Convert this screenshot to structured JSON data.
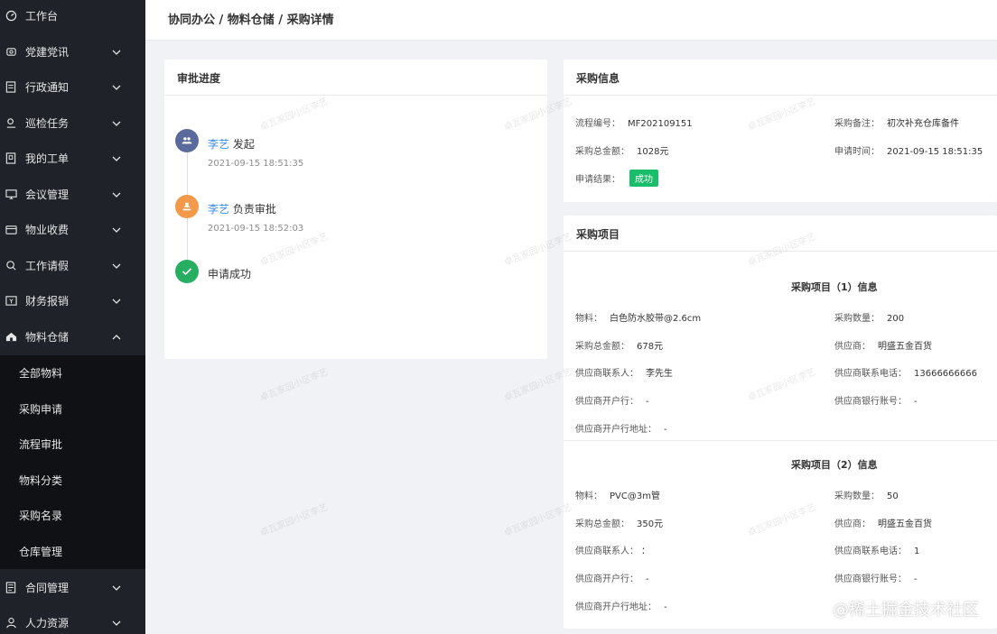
{
  "breadcrumb": "协同办公 / 物料仓储 / 采购详情",
  "sidebar": {
    "items": [
      {
        "label": "工作台",
        "icon": "dashboard-icon",
        "chevron": false
      },
      {
        "label": "党建党讯",
        "icon": "flag-icon",
        "chevron": true
      },
      {
        "label": "行政通知",
        "icon": "document-icon",
        "chevron": true
      },
      {
        "label": "巡检任务",
        "icon": "patrol-icon",
        "chevron": true
      },
      {
        "label": "我的工单",
        "icon": "ticket-icon",
        "chevron": true
      },
      {
        "label": "会议管理",
        "icon": "meeting-icon",
        "chevron": true
      },
      {
        "label": "物业收费",
        "icon": "fee-icon",
        "chevron": true
      },
      {
        "label": "工作请假",
        "icon": "leave-icon",
        "chevron": true
      },
      {
        "label": "财务报销",
        "icon": "finance-icon",
        "chevron": true
      },
      {
        "label": "物料仓储",
        "icon": "home-icon",
        "chevron": true,
        "expanded": true
      }
    ],
    "submenu": [
      "全部物料",
      "采购申请",
      "流程审批",
      "物料分类",
      "采购名录",
      "仓库管理"
    ],
    "bottom_items": [
      {
        "label": "合同管理",
        "icon": "contract-icon"
      },
      {
        "label": "人力资源",
        "icon": "user-icon"
      }
    ]
  },
  "approval": {
    "title": "审批进度",
    "steps": [
      {
        "who": "李艺",
        "action": "发起",
        "time": "2021-09-15 18:51:35",
        "icon": "group-icon",
        "color": "#5a6a9a"
      },
      {
        "who": "李艺",
        "action": "负责审批",
        "time": "2021-09-15 18:52:03",
        "icon": "stamp-icon",
        "color": "#f2994a"
      },
      {
        "who": "",
        "action": "申请成功",
        "time": "",
        "icon": "check-icon",
        "color": "#27ae60"
      }
    ]
  },
  "purchase_info": {
    "title": "采购信息",
    "flow_no_label": "流程编号：",
    "flow_no": "MF202109151",
    "remark_label": "采购备注：",
    "remark": "初次补充仓库备件",
    "total_label": "采购总金额：",
    "total": "1028元",
    "apply_time_label": "申请时间：",
    "apply_time": "2021-09-15 18:51:35",
    "result_label": "申请结果：",
    "result": "成功"
  },
  "purchase_items": {
    "title": "采购项目",
    "items": [
      {
        "heading": "采购项目（1）信息",
        "material_label": "物料：",
        "material": "白色防水胶带@2.6cm",
        "qty_label": "采购数量：",
        "qty": "200",
        "total_label": "采购总金额：",
        "total": "678元",
        "supplier_label": "供应商：",
        "supplier": "明盛五金百货",
        "contact_label": "供应商联系人：",
        "contact": "李先生",
        "phone_label": "供应商联系电话：",
        "phone": "13666666666",
        "bank_label": "供应商开户行：",
        "bank": "-",
        "account_label": "供应商银行账号：",
        "account": "-",
        "bank_addr_label": "供应商开户行地址：",
        "bank_addr": "-"
      },
      {
        "heading": "采购项目（2）信息",
        "material_label": "物料：",
        "material": "PVC@3m管",
        "qty_label": "采购数量：",
        "qty": "50",
        "total_label": "采购总金额：",
        "total": "350元",
        "supplier_label": "供应商：",
        "supplier": "明盛五金百货",
        "contact_label": "供应商联系人：",
        "contact": "：",
        "phone_label": "供应商联系电话：",
        "phone": "1",
        "bank_label": "供应商开户行：",
        "bank": "-",
        "account_label": "供应商银行账号：",
        "account": "-",
        "bank_addr_label": "供应商开户行地址：",
        "bank_addr": "-"
      }
    ]
  },
  "watermark_text": "卓瓦家园小区李艺",
  "footer_watermark": "@稀土掘金技术社区",
  "colors": {
    "sidebar_bg": "#1f2229",
    "submenu_bg": "#0f1115",
    "link": "#3a8ee6",
    "success": "#19be6b"
  }
}
